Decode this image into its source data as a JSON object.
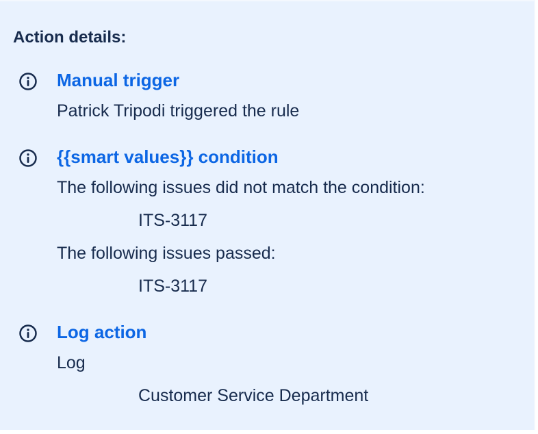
{
  "panel": {
    "heading": "Action details:"
  },
  "actions": [
    {
      "title": "Manual trigger",
      "icon": "info-icon",
      "lines": [
        "Patrick Tripodi triggered the rule"
      ]
    },
    {
      "title": "{{smart values}} condition",
      "icon": "info-icon",
      "lines": [
        "The following issues did not match the condition:",
        "ITS-3117",
        "The following issues passed:",
        "ITS-3117"
      ]
    },
    {
      "title": "Log action",
      "icon": "info-icon",
      "lines": [
        "Log",
        "Customer Service Department"
      ]
    }
  ],
  "colors": {
    "panel_background": "#e9f2fe",
    "link": "#0c66e4",
    "text": "#172b4d"
  }
}
